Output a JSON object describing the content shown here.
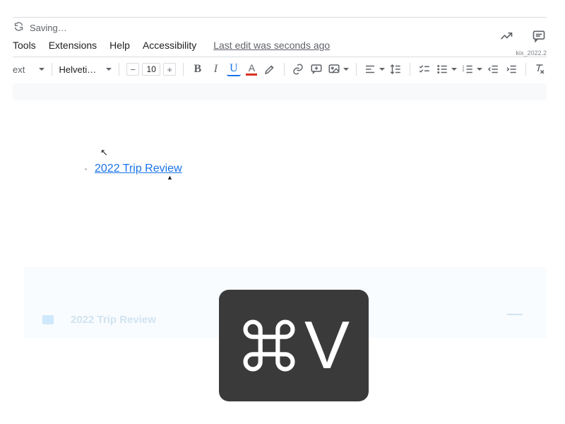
{
  "header": {
    "saving_text": "Saving…",
    "last_edit": "Last edit was seconds ago",
    "version": "kix_2022.2"
  },
  "menu": {
    "tools": "Tools",
    "extensions": "Extensions",
    "help": "Help",
    "accessibility": "Accessibility"
  },
  "toolbar": {
    "styles_dd": "ext",
    "font": "Helvetica …",
    "font_size": "10",
    "minus": "−",
    "plus": "+",
    "bold": "B",
    "italic": "I",
    "underline": "U",
    "text_color_letter": "A"
  },
  "document": {
    "link_text": "2022 Trip Review"
  },
  "lower": {
    "faded_title": "2022 Trip Review"
  },
  "overlay": {
    "key": "V"
  }
}
